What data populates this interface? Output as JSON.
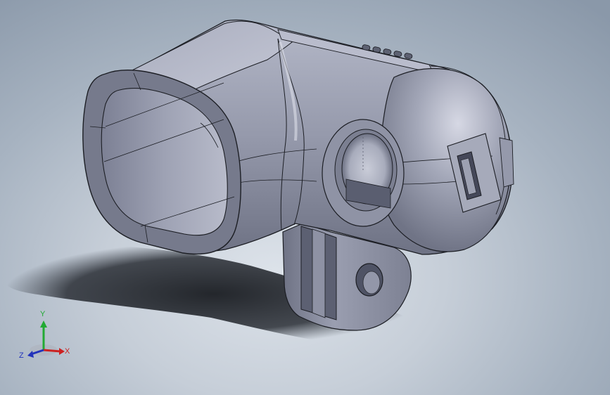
{
  "viewport": {
    "background_top": "#8a98a9",
    "background_bottom": "#dde3ea",
    "model_color": "#8d90a3"
  },
  "triad": {
    "x_label": "X",
    "y_label": "Y",
    "z_label": "Z",
    "x_color": "#cc2222",
    "y_color": "#22aa33",
    "z_color": "#2233bb"
  }
}
